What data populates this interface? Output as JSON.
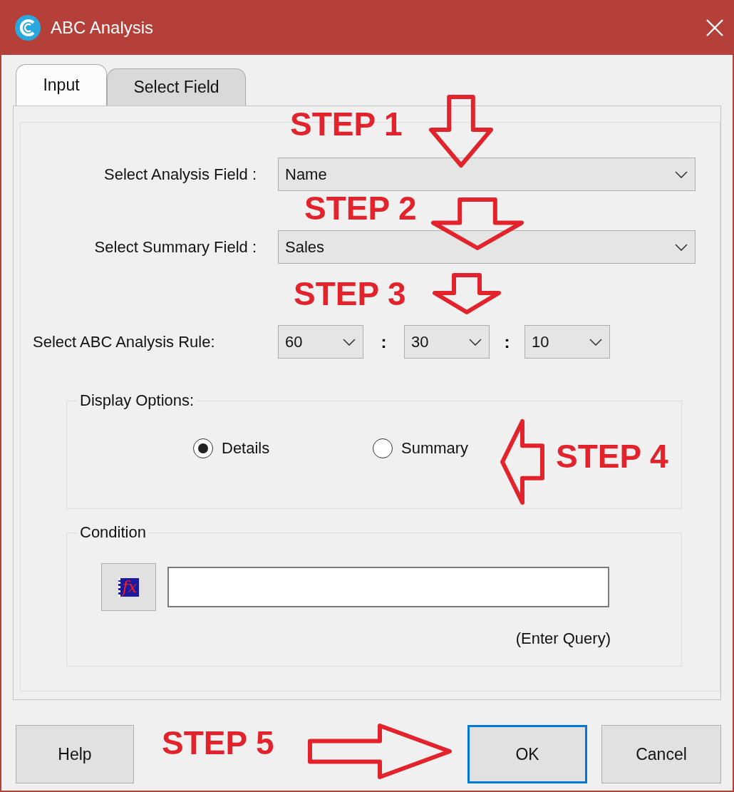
{
  "window": {
    "title": "ABC Analysis"
  },
  "tabs": [
    {
      "label": "Input",
      "selected": true
    },
    {
      "label": "Select Field",
      "selected": false
    }
  ],
  "fields": [
    {
      "label": "Select Analysis Field :",
      "value": "Name"
    },
    {
      "label": "Select Summary Field :",
      "value": "Sales"
    }
  ],
  "rule": {
    "label": "Select ABC Analysis Rule:",
    "values": [
      "60",
      "30",
      "10"
    ],
    "separator": ":"
  },
  "display_options": {
    "legend": "Display Options:",
    "options": [
      {
        "label": "Details",
        "selected": true
      },
      {
        "label": "Summary",
        "selected": false
      }
    ]
  },
  "condition": {
    "legend": "Condition",
    "formula_button": "fx",
    "hint": "(Enter Query)"
  },
  "buttons": [
    {
      "label": "Help",
      "focused": false
    },
    {
      "label": "OK",
      "focused": true
    },
    {
      "label": "Cancel",
      "focused": false
    }
  ],
  "annotations": [
    {
      "text": "STEP 1",
      "kind": "down"
    },
    {
      "text": "STEP 2",
      "kind": "down"
    },
    {
      "text": "STEP 3",
      "kind": "down"
    },
    {
      "text": "STEP 4",
      "kind": "left"
    },
    {
      "text": "STEP 5",
      "kind": "right"
    }
  ]
}
